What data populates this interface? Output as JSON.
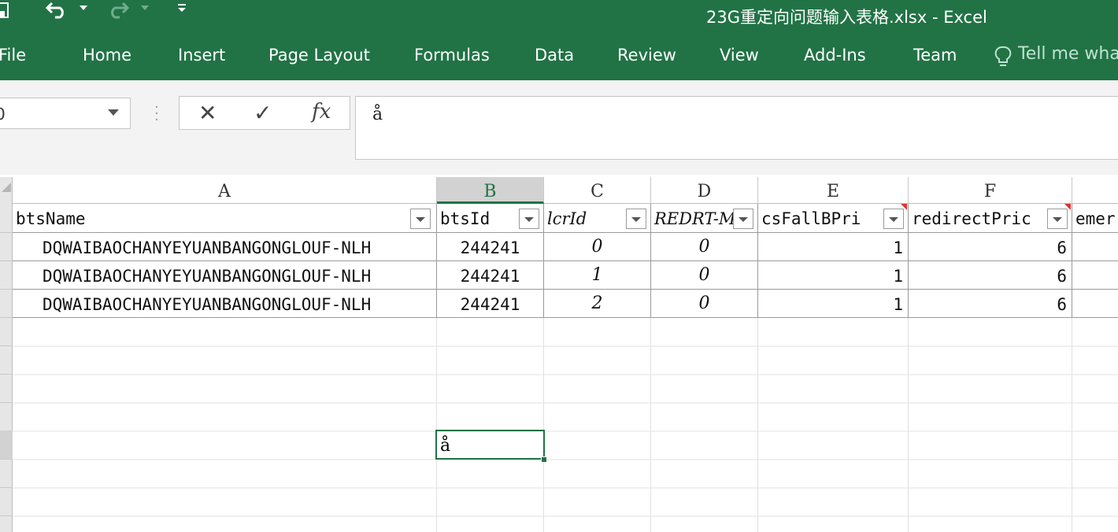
{
  "window": {
    "title": "23G重定向问题输入表格.xlsx - Excel"
  },
  "ribbon": {
    "tabs": [
      "File",
      "Home",
      "Insert",
      "Page Layout",
      "Formulas",
      "Data",
      "Review",
      "View",
      "Add-Ins",
      "Team"
    ],
    "tell_me": "Tell me wha"
  },
  "formula_bar": {
    "name_box": "0",
    "cancel_glyph": "✕",
    "enter_glyph": "✓",
    "fx_label": "fx",
    "content": "å"
  },
  "sheet": {
    "column_headers": [
      "A",
      "B",
      "C",
      "D",
      "E",
      "F"
    ],
    "selected_column": "B",
    "table_headers": [
      "btsName",
      "btsId",
      "lcrId",
      "REDRT-M",
      "csFallBPri",
      "redirectPric",
      "emer"
    ],
    "rows": [
      [
        "DQWAIBAOCHANYEYUANBANGONGLOUF-NLH",
        "244241",
        "0",
        "0",
        "1",
        "6"
      ],
      [
        "DQWAIBAOCHANYEYUANBANGONGLOUF-NLH",
        "244241",
        "1",
        "0",
        "1",
        "6"
      ],
      [
        "DQWAIBAOCHANYEYUANBANGONGLOUF-NLH",
        "244241",
        "2",
        "0",
        "1",
        "6"
      ]
    ],
    "active_cell_value": "å"
  },
  "colors": {
    "accent": "#217346"
  }
}
